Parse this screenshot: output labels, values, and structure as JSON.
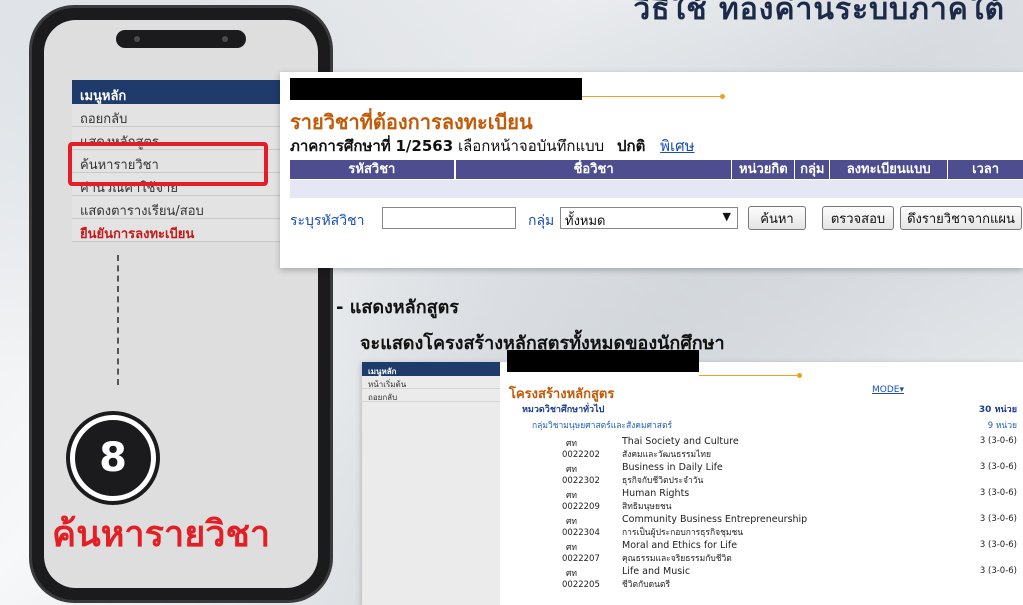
{
  "header": {
    "title": "วิธีใช้ ทองค่านระบบภาคใต้"
  },
  "phone": {
    "menu_title": "เมนูหลัก",
    "menu_items": [
      {
        "label": "ถอยกลับ",
        "highlight": false
      },
      {
        "label": "แสดงหลักสูตร",
        "highlight": false
      },
      {
        "label": "ค้นหารายวิชา",
        "highlight": false
      },
      {
        "label": "คำนวณค่าใช้จ่าย",
        "highlight": false
      },
      {
        "label": "แสดงตารางเรียน/สอบ",
        "highlight": false
      },
      {
        "label": "ยืนยันการลงทะเบียน",
        "highlight": true
      }
    ],
    "step_number": "8",
    "step_caption": "ค้นหารายวิชา"
  },
  "registration": {
    "title": "รายวิชาที่ต้องการลงทะเบียน",
    "semester_prefix": "ภาคการศึกษาที่",
    "semester": "1/2563",
    "form_select_text": "เลือกหน้าจอบันทึกแบบ",
    "mode_normal": "ปกติ",
    "mode_special": "พิเศษ",
    "columns": [
      "รหัสวิชา",
      "",
      "ชื่อวิชา",
      "หน่วยกิต",
      "กลุ่ม",
      "ลงทะเบียนแบบ",
      "เวลา"
    ],
    "search_label": "ระบุรหัสวิชา",
    "search_value": "",
    "group_label": "กลุ่ม",
    "group_selected": "ทั้งหมด",
    "btn_search": "ค้นหา",
    "btn_check": "ตรวจสอบ",
    "btn_pull": "ดึงรายวิชาจากแผน"
  },
  "section": {
    "title": "- แสดงหลักสูตร",
    "description": "จะแสดงโครงสร้างหลักสูตรทั้งหมดของนักศึกษา"
  },
  "curriculum": {
    "menu_title": "เมนูหลัก",
    "menu_items": [
      "หน้าเริ่มต้น",
      "ถอยกลับ"
    ],
    "title": "โครงสร้างหลักสูตร",
    "mode_label": "MODE▾",
    "category": "หมวดวิชาศึกษาทั่วไป",
    "category_units": "30 หน่วย",
    "group": "กลุ่มวิชามนุษยศาสตร์และสังคมศาสตร์",
    "group_units": "9 หน่วย",
    "courses": [
      {
        "prefix": "ศท",
        "code": "0022202",
        "name_en": "Thai Society and Culture",
        "name_th": "สังคมและวัฒนธรรมไทย",
        "credit": "3 (3-0-6)"
      },
      {
        "prefix": "ศท",
        "code": "0022302",
        "name_en": "Business in Daily Life",
        "name_th": "ธุรกิจกับชีวิตประจำวัน",
        "credit": "3 (3-0-6)"
      },
      {
        "prefix": "ศท",
        "code": "0022209",
        "name_en": "Human Rights",
        "name_th": "สิทธิมนุษยชน",
        "credit": "3 (3-0-6)"
      },
      {
        "prefix": "ศท",
        "code": "0022304",
        "name_en": "Community Business Entrepreneurship",
        "name_th": "การเป็นผู้ประกอบการธุรกิจชุมชน",
        "credit": "3 (3-0-6)"
      },
      {
        "prefix": "ศท",
        "code": "0022207",
        "name_en": "Moral and Ethics for Life",
        "name_th": "คุณธรรมและจริยธรรมกับชีวิต",
        "credit": "3 (3-0-6)"
      },
      {
        "prefix": "ศท",
        "code": "0022205",
        "name_en": "Life and Music",
        "name_th": "ชีวิตกับดนตรี",
        "credit": "3 (3-0-6)"
      }
    ]
  },
  "colors": {
    "accent_red": "#e31e24",
    "navy": "#1f3b6b",
    "orange": "#c25b08",
    "header_purple": "#4d4d8f"
  }
}
